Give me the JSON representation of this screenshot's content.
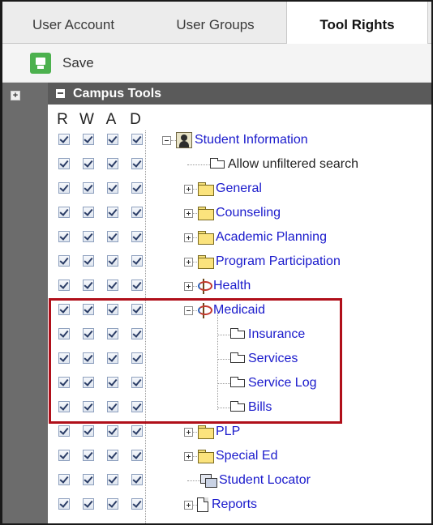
{
  "tabs": [
    {
      "label": "User Account",
      "active": false
    },
    {
      "label": "User Groups",
      "active": false
    },
    {
      "label": "Tool Rights",
      "active": true
    }
  ],
  "toolbar": {
    "save_label": "Save",
    "save_color": "#4cb14e"
  },
  "header": {
    "title": "Campus Tools",
    "expand_symbol": "+"
  },
  "columns": [
    "R",
    "W",
    "A",
    "D"
  ],
  "tree": [
    {
      "label": "Student Information",
      "icon": "student-info-icon",
      "expander": "minus",
      "link": true
    },
    {
      "label": "Allow unfiltered search",
      "icon": "tool-icon",
      "expander": null,
      "link": false
    },
    {
      "label": "General",
      "icon": "folder-icon",
      "expander": "plus",
      "link": true
    },
    {
      "label": "Counseling",
      "icon": "folder-icon",
      "expander": "plus",
      "link": true
    },
    {
      "label": "Academic Planning",
      "icon": "folder-icon",
      "expander": "plus",
      "link": true
    },
    {
      "label": "Program Participation",
      "icon": "folder-icon",
      "expander": "plus",
      "link": true
    },
    {
      "label": "Health",
      "icon": "caduceus-icon",
      "expander": "plus",
      "link": true
    },
    {
      "label": "Medicaid",
      "icon": "caduceus-icon",
      "expander": "minus",
      "link": true
    },
    {
      "label": "Insurance",
      "icon": "tool-icon",
      "expander": null,
      "link": true
    },
    {
      "label": "Services",
      "icon": "tool-icon",
      "expander": null,
      "link": true
    },
    {
      "label": "Service Log",
      "icon": "tool-icon",
      "expander": null,
      "link": true
    },
    {
      "label": "Bills",
      "icon": "tool-icon",
      "expander": null,
      "link": true
    },
    {
      "label": "PLP",
      "icon": "folder-icon",
      "expander": "plus",
      "link": true
    },
    {
      "label": "Special Ed",
      "icon": "folder-icon",
      "expander": "plus",
      "link": true
    },
    {
      "label": "Student Locator",
      "icon": "locator-icon",
      "expander": null,
      "link": true
    },
    {
      "label": "Reports",
      "icon": "document-icon",
      "expander": "plus",
      "link": true
    }
  ],
  "colors": {
    "link": "#1a1acc",
    "highlight": "#b00f1a",
    "header_bg": "#5a5a5a",
    "gutter_bg": "#6c6c6c"
  }
}
